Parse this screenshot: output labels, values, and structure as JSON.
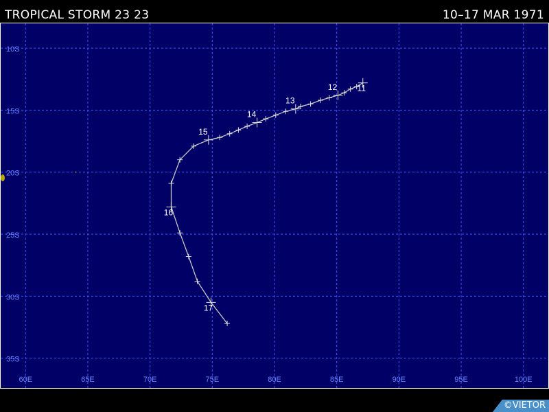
{
  "header": {
    "storm_title": "TROPICAL STORM 23 23",
    "date_range": "10–17 MAR 1971"
  },
  "map": {
    "background_color": "#000066",
    "grid_color": "#3a5aff",
    "axis_label_color": "#6a86ff",
    "track_color": "#c8c8c8",
    "lon_range": [
      58,
      102
    ],
    "lat_range": [
      -8,
      -37.4
    ],
    "lat_labels": [
      {
        "lat": -10,
        "label": "10S"
      },
      {
        "lat": -15,
        "label": "15S"
      },
      {
        "lat": -20,
        "label": "20S"
      },
      {
        "lat": -25,
        "label": "25S"
      },
      {
        "lat": -30,
        "label": "30S"
      },
      {
        "lat": -35,
        "label": "35S"
      }
    ],
    "lon_labels": [
      {
        "lon": 60,
        "label": "60E"
      },
      {
        "lon": 65,
        "label": "65E"
      },
      {
        "lon": 70,
        "label": "70E"
      },
      {
        "lon": 75,
        "label": "75E"
      },
      {
        "lon": 80,
        "label": "80E"
      },
      {
        "lon": 85,
        "label": "85E"
      },
      {
        "lon": 90,
        "label": "90E"
      },
      {
        "lon": 95,
        "label": "95E"
      },
      {
        "lon": 100,
        "label": "100E"
      }
    ],
    "track": [
      {
        "lon": 87.1,
        "lat": -12.8,
        "day": "11"
      },
      {
        "lon": 86.6,
        "lat": -13.1
      },
      {
        "lon": 86.1,
        "lat": -13.3
      },
      {
        "lon": 85.6,
        "lat": -13.6
      },
      {
        "lon": 85.1,
        "lat": -13.8,
        "day": "12"
      },
      {
        "lon": 84.4,
        "lat": -14.0
      },
      {
        "lon": 83.7,
        "lat": -14.2
      },
      {
        "lon": 82.9,
        "lat": -14.5
      },
      {
        "lon": 82.1,
        "lat": -14.7
      },
      {
        "lon": 81.7,
        "lat": -14.9,
        "day": "13"
      },
      {
        "lon": 80.9,
        "lat": -15.1
      },
      {
        "lon": 80.1,
        "lat": -15.4
      },
      {
        "lon": 79.3,
        "lat": -15.7
      },
      {
        "lon": 78.6,
        "lat": -16.0,
        "day": "14"
      },
      {
        "lon": 77.8,
        "lat": -16.3
      },
      {
        "lon": 77.1,
        "lat": -16.6
      },
      {
        "lon": 76.4,
        "lat": -16.9
      },
      {
        "lon": 75.6,
        "lat": -17.2
      },
      {
        "lon": 74.7,
        "lat": -17.4,
        "day": "15"
      },
      {
        "lon": 73.5,
        "lat": -17.9
      },
      {
        "lon": 72.4,
        "lat": -19.0
      },
      {
        "lon": 71.7,
        "lat": -20.9
      },
      {
        "lon": 71.7,
        "lat": -22.8,
        "day": "16"
      },
      {
        "lon": 72.4,
        "lat": -24.9
      },
      {
        "lon": 73.1,
        "lat": -26.8
      },
      {
        "lon": 73.8,
        "lat": -28.8
      },
      {
        "lon": 74.9,
        "lat": -30.5,
        "day": "17"
      },
      {
        "lon": 76.2,
        "lat": -32.2
      }
    ]
  },
  "credit": "©VIETOR"
}
